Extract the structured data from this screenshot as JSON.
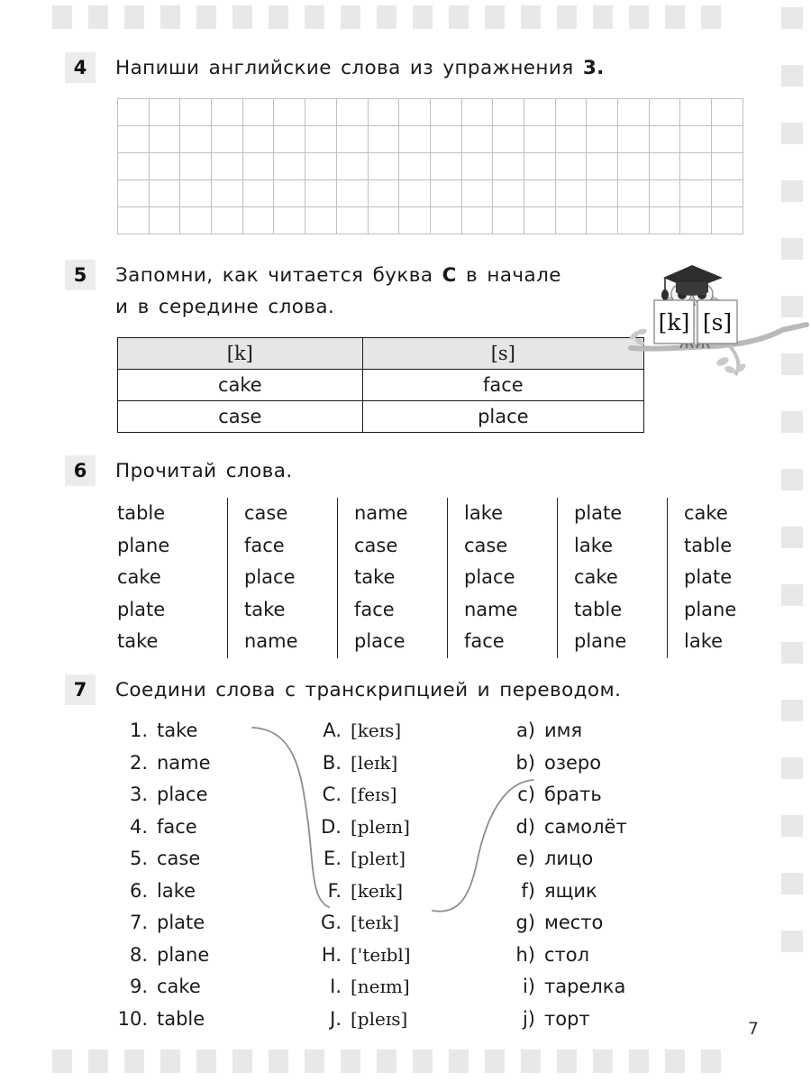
{
  "page": {
    "number": "7"
  },
  "exercises": [
    {
      "id": "ex4",
      "number": "4",
      "instruction": "Напиши английские слова из упражнения 3.",
      "instruction_bold_tail": "3.",
      "grid": {
        "rows": 5,
        "cols": 20
      }
    },
    {
      "id": "ex5",
      "number": "5",
      "instruction": "Запомни, как читается буква C в начале\nи в середине слова.",
      "table": {
        "headers": [
          "[k]",
          "[s]"
        ],
        "rows": [
          [
            "cake",
            "face"
          ],
          [
            "case",
            "place"
          ]
        ]
      },
      "illustration": {
        "name": "owl-scholar",
        "card_left": "[k]",
        "card_right": "[s]"
      }
    },
    {
      "id": "ex6",
      "number": "6",
      "instruction": "Прочитай слова.",
      "columns": [
        [
          "table",
          "plane",
          "cake",
          "plate",
          "take"
        ],
        [
          "case",
          "face",
          "place",
          "take",
          "name"
        ],
        [
          "name",
          "case",
          "take",
          "face",
          "place"
        ],
        [
          "lake",
          "case",
          "place",
          "name",
          "face"
        ],
        [
          "plate",
          "lake",
          "cake",
          "table",
          "plane"
        ],
        [
          "cake",
          "table",
          "plate",
          "plane",
          "lake"
        ]
      ]
    },
    {
      "id": "ex7",
      "number": "7",
      "instruction": "Соедини слова с транскрипцией и переводом.",
      "words": [
        {
          "key": "1.",
          "value": "take"
        },
        {
          "key": "2.",
          "value": "name"
        },
        {
          "key": "3.",
          "value": "place"
        },
        {
          "key": "4.",
          "value": "face"
        },
        {
          "key": "5.",
          "value": "case"
        },
        {
          "key": "6.",
          "value": "lake"
        },
        {
          "key": "7.",
          "value": "plate"
        },
        {
          "key": "8.",
          "value": "plane"
        },
        {
          "key": "9.",
          "value": "cake"
        },
        {
          "key": "10.",
          "value": "table"
        }
      ],
      "transcriptions": [
        {
          "key": "A.",
          "value": "[keɪs]"
        },
        {
          "key": "B.",
          "value": "[leɪk]"
        },
        {
          "key": "C.",
          "value": "[feɪs]"
        },
        {
          "key": "D.",
          "value": "[pleɪn]"
        },
        {
          "key": "E.",
          "value": "[pleɪt]"
        },
        {
          "key": "F.",
          "value": "[keɪk]"
        },
        {
          "key": "G.",
          "value": "[teɪk]"
        },
        {
          "key": "H.",
          "value": "['teɪbl]"
        },
        {
          "key": "I.",
          "value": "[neɪm]"
        },
        {
          "key": "J.",
          "value": "[pleɪs]"
        }
      ],
      "translations": [
        {
          "key": "a)",
          "value": "имя"
        },
        {
          "key": "b)",
          "value": "озеро"
        },
        {
          "key": "c)",
          "value": "брать"
        },
        {
          "key": "d)",
          "value": "самолёт"
        },
        {
          "key": "e)",
          "value": "лицо"
        },
        {
          "key": "f)",
          "value": "ящик"
        },
        {
          "key": "g)",
          "value": "место"
        },
        {
          "key": "h)",
          "value": "стол"
        },
        {
          "key": "i)",
          "value": "тарелка"
        },
        {
          "key": "j)",
          "value": "торт"
        }
      ],
      "connections": [
        {
          "from": "1",
          "to": "G"
        },
        {
          "from": "G",
          "to": "c"
        }
      ]
    }
  ],
  "decor": {
    "square_color": "#e8e8e8",
    "top_squares": 19,
    "bottom_squares": 19,
    "side_squares": 17
  }
}
